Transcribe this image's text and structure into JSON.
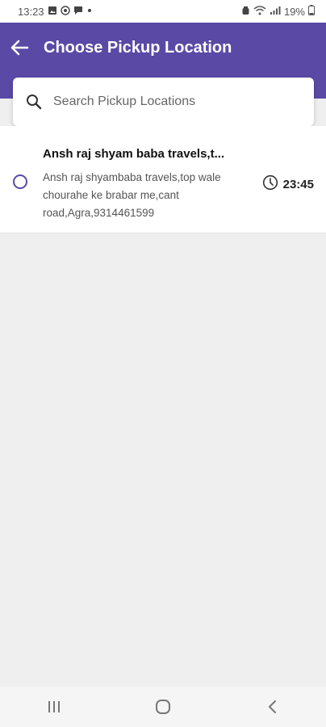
{
  "status_bar": {
    "time": "13:23",
    "battery": "19%",
    "left_icons": [
      "gallery-icon",
      "whatsapp-icon",
      "chat-icon",
      "dot-icon"
    ],
    "right_icons": [
      "alarm-icon",
      "wifi-icon",
      "signal-icon",
      "battery-icon"
    ]
  },
  "header": {
    "title": "Choose Pickup Location",
    "back_icon": "arrow-left-icon",
    "color": "#5a4aa6"
  },
  "search": {
    "placeholder": "Search Pickup Locations",
    "value": "",
    "icon": "search-icon"
  },
  "locations": [
    {
      "name": "Ansh raj shyam baba travels,t...",
      "address": "Ansh raj shyambaba travels,top wale chourahe ke brabar me,cant road,Agra,9314461599",
      "time": "23:45",
      "selected": false
    }
  ],
  "nav_bar": {
    "buttons": [
      "recent-apps-icon",
      "home-icon",
      "back-icon"
    ]
  }
}
